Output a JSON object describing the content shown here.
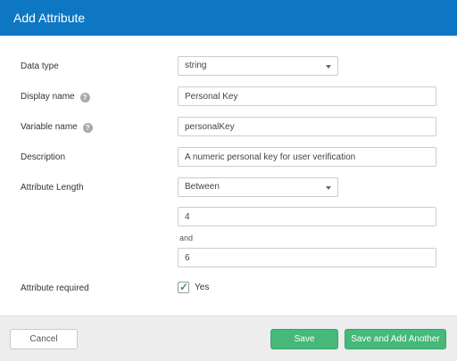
{
  "dialog": {
    "title": "Add Attribute"
  },
  "form": {
    "data_type": {
      "label": "Data type",
      "value": "string"
    },
    "display_name": {
      "label": "Display name",
      "value": "Personal Key",
      "help_icon": "question-circle-icon"
    },
    "variable_name": {
      "label": "Variable name",
      "value": "personalKey",
      "help_icon": "question-circle-icon"
    },
    "description": {
      "label": "Description",
      "value": "A numeric personal key for user verification"
    },
    "attribute_length": {
      "label": "Attribute Length",
      "mode": "Between",
      "min": "4",
      "and_label": "and",
      "max": "6"
    },
    "required": {
      "label": "Attribute required",
      "checked": true,
      "checkbox_label": "Yes"
    }
  },
  "footer": {
    "cancel_label": "Cancel",
    "save_label": "Save",
    "save_another_label": "Save and Add Another"
  },
  "colors": {
    "header": "#0d77c4",
    "primary_button": "#46b879",
    "checkmark": "#3a9a56"
  }
}
